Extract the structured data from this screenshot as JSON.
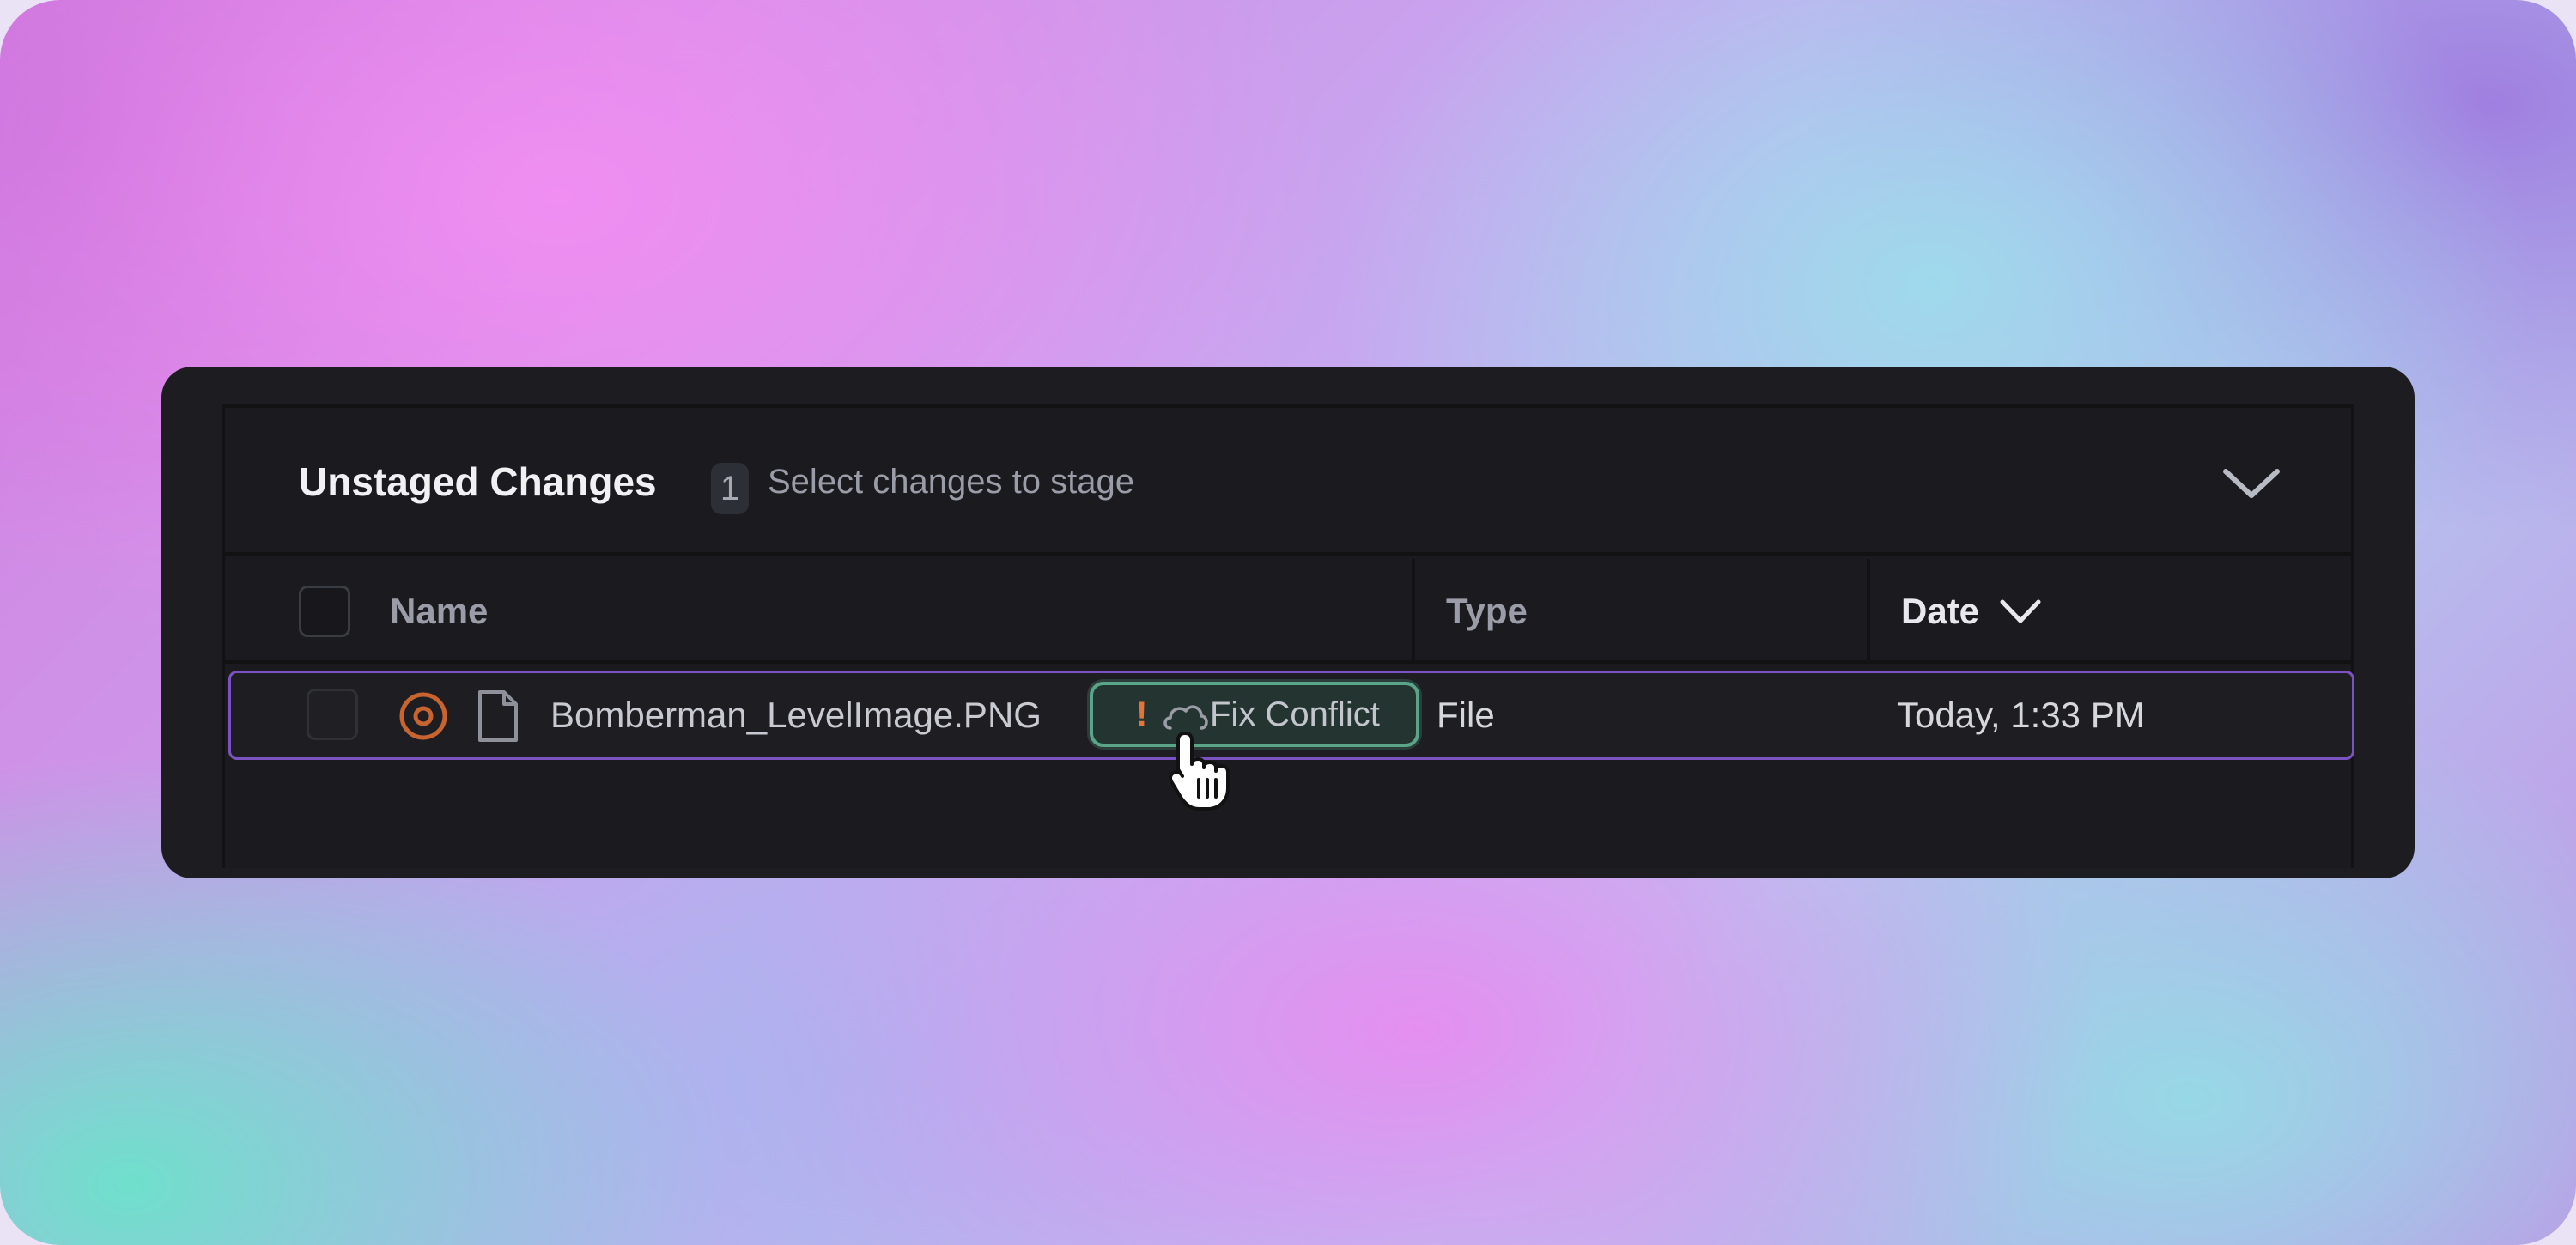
{
  "section": {
    "title": "Unstaged Changes",
    "count": "1",
    "subtitle": "Select changes to stage",
    "collapse_icon": "chevron-down-icon"
  },
  "columns": {
    "name": "Name",
    "type": "Type",
    "date": "Date",
    "sort_icon": "chevron-down-icon"
  },
  "rows": [
    {
      "status_icon": "conflict-status-icon",
      "file_icon": "file-icon",
      "name": "Bomberman_LevelImage.PNG",
      "action": {
        "alert": "!",
        "icon": "cloud-icon",
        "label": "Fix Conflict"
      },
      "type": "File",
      "date": "Today, 1:33 PM"
    }
  ],
  "colors": {
    "panel_bg": "#1d1d21",
    "row_highlight": "#7a52c2",
    "conflict_orange": "#c8642f",
    "fix_button_border": "#5aa58a"
  }
}
